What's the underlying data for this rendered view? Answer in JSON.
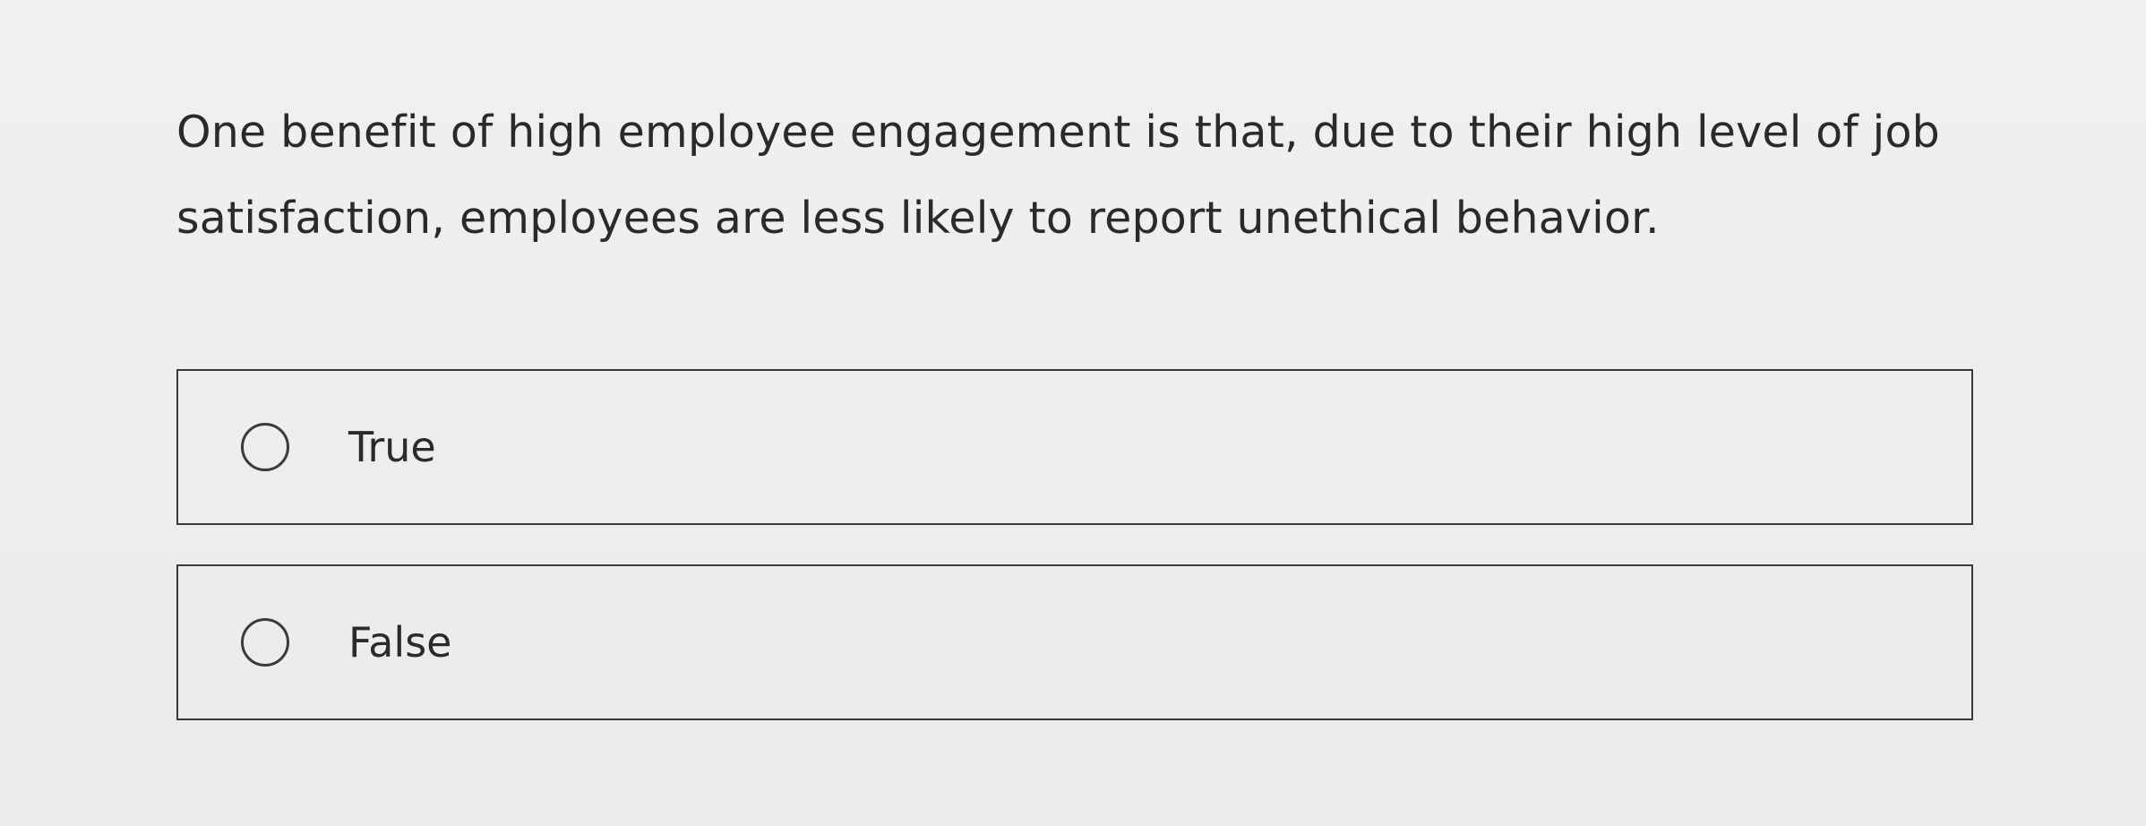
{
  "question": {
    "line1": "One benefit of high employee engagement is that, due to their high level of job",
    "line2": "satisfaction, employees are less likely to report unethical behavior."
  },
  "options": [
    {
      "label": "True",
      "icon": "radio-unselected-icon",
      "selected": false
    },
    {
      "label": "False",
      "icon": "radio-unselected-icon",
      "selected": false
    }
  ]
}
